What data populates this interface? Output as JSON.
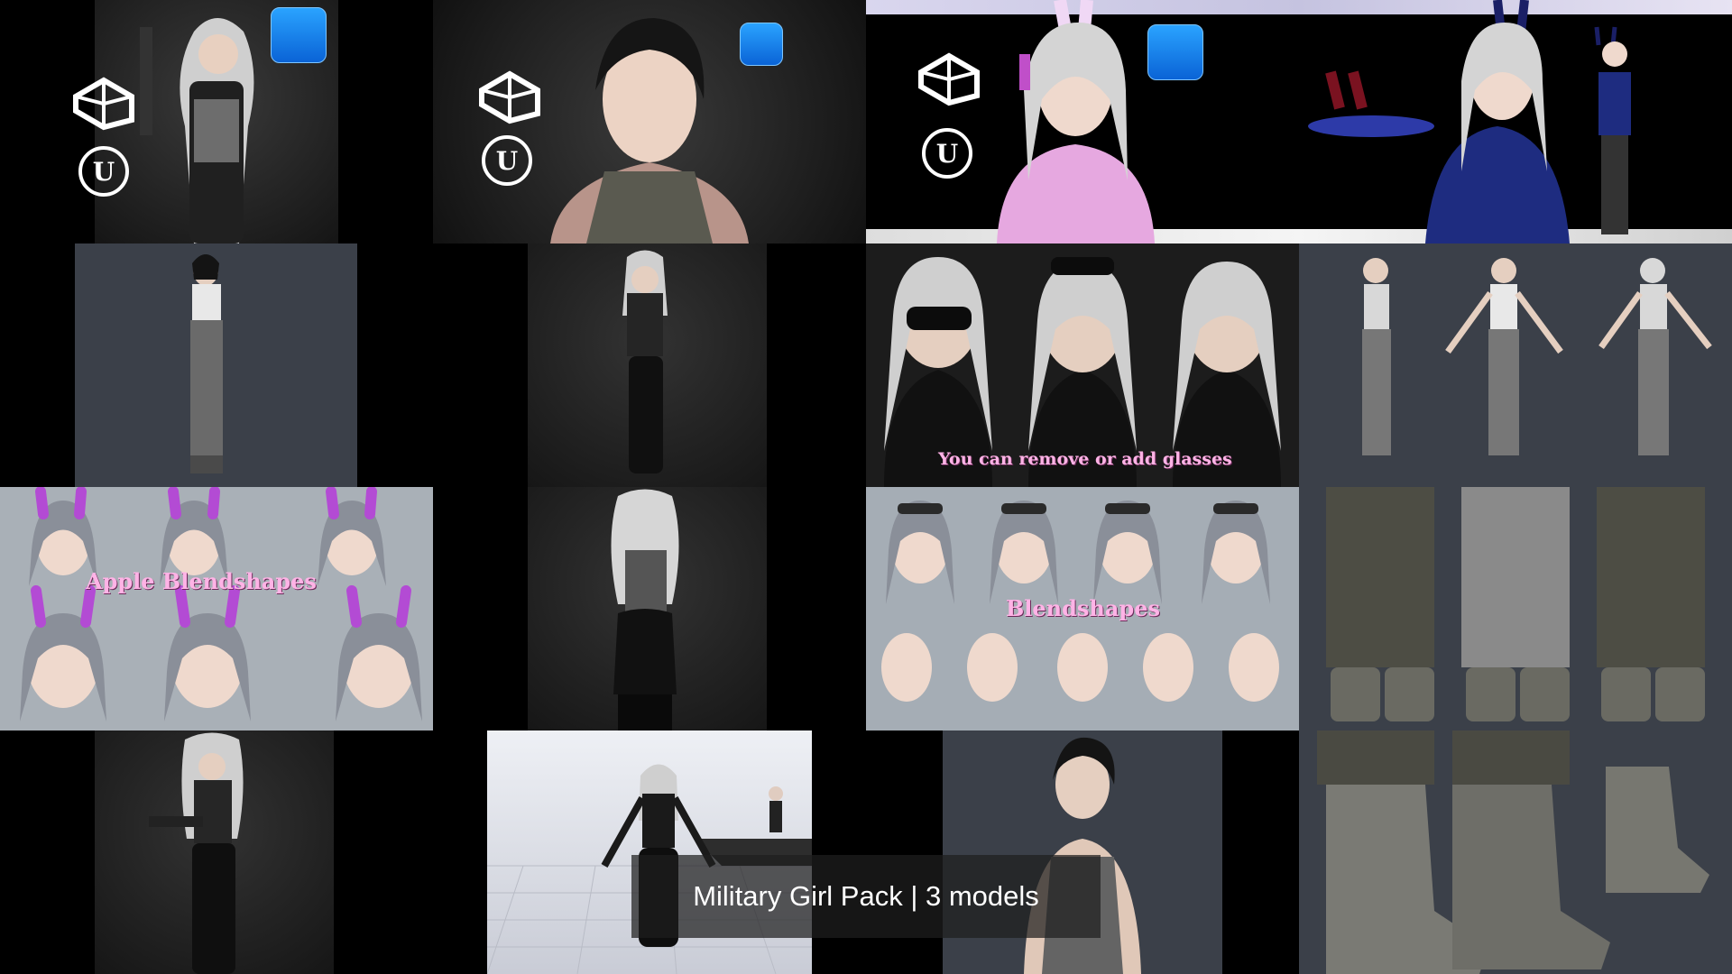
{
  "caption": "Military Girl Pack | 3 models",
  "overlays": {
    "glasses": "You can remove or add glasses",
    "apple": "Apple Blendshapes",
    "blend": "Blendshapes"
  },
  "icons": [
    "unity-logo-icon",
    "unreal-logo-icon",
    "face-capture-app-icon"
  ],
  "colors": {
    "background": "#000000",
    "tile_dark": "#1a1a1a",
    "tile_gray": "#3b4049",
    "pink_text": "#ffb3e6",
    "app_blue": "#1b82ff"
  }
}
